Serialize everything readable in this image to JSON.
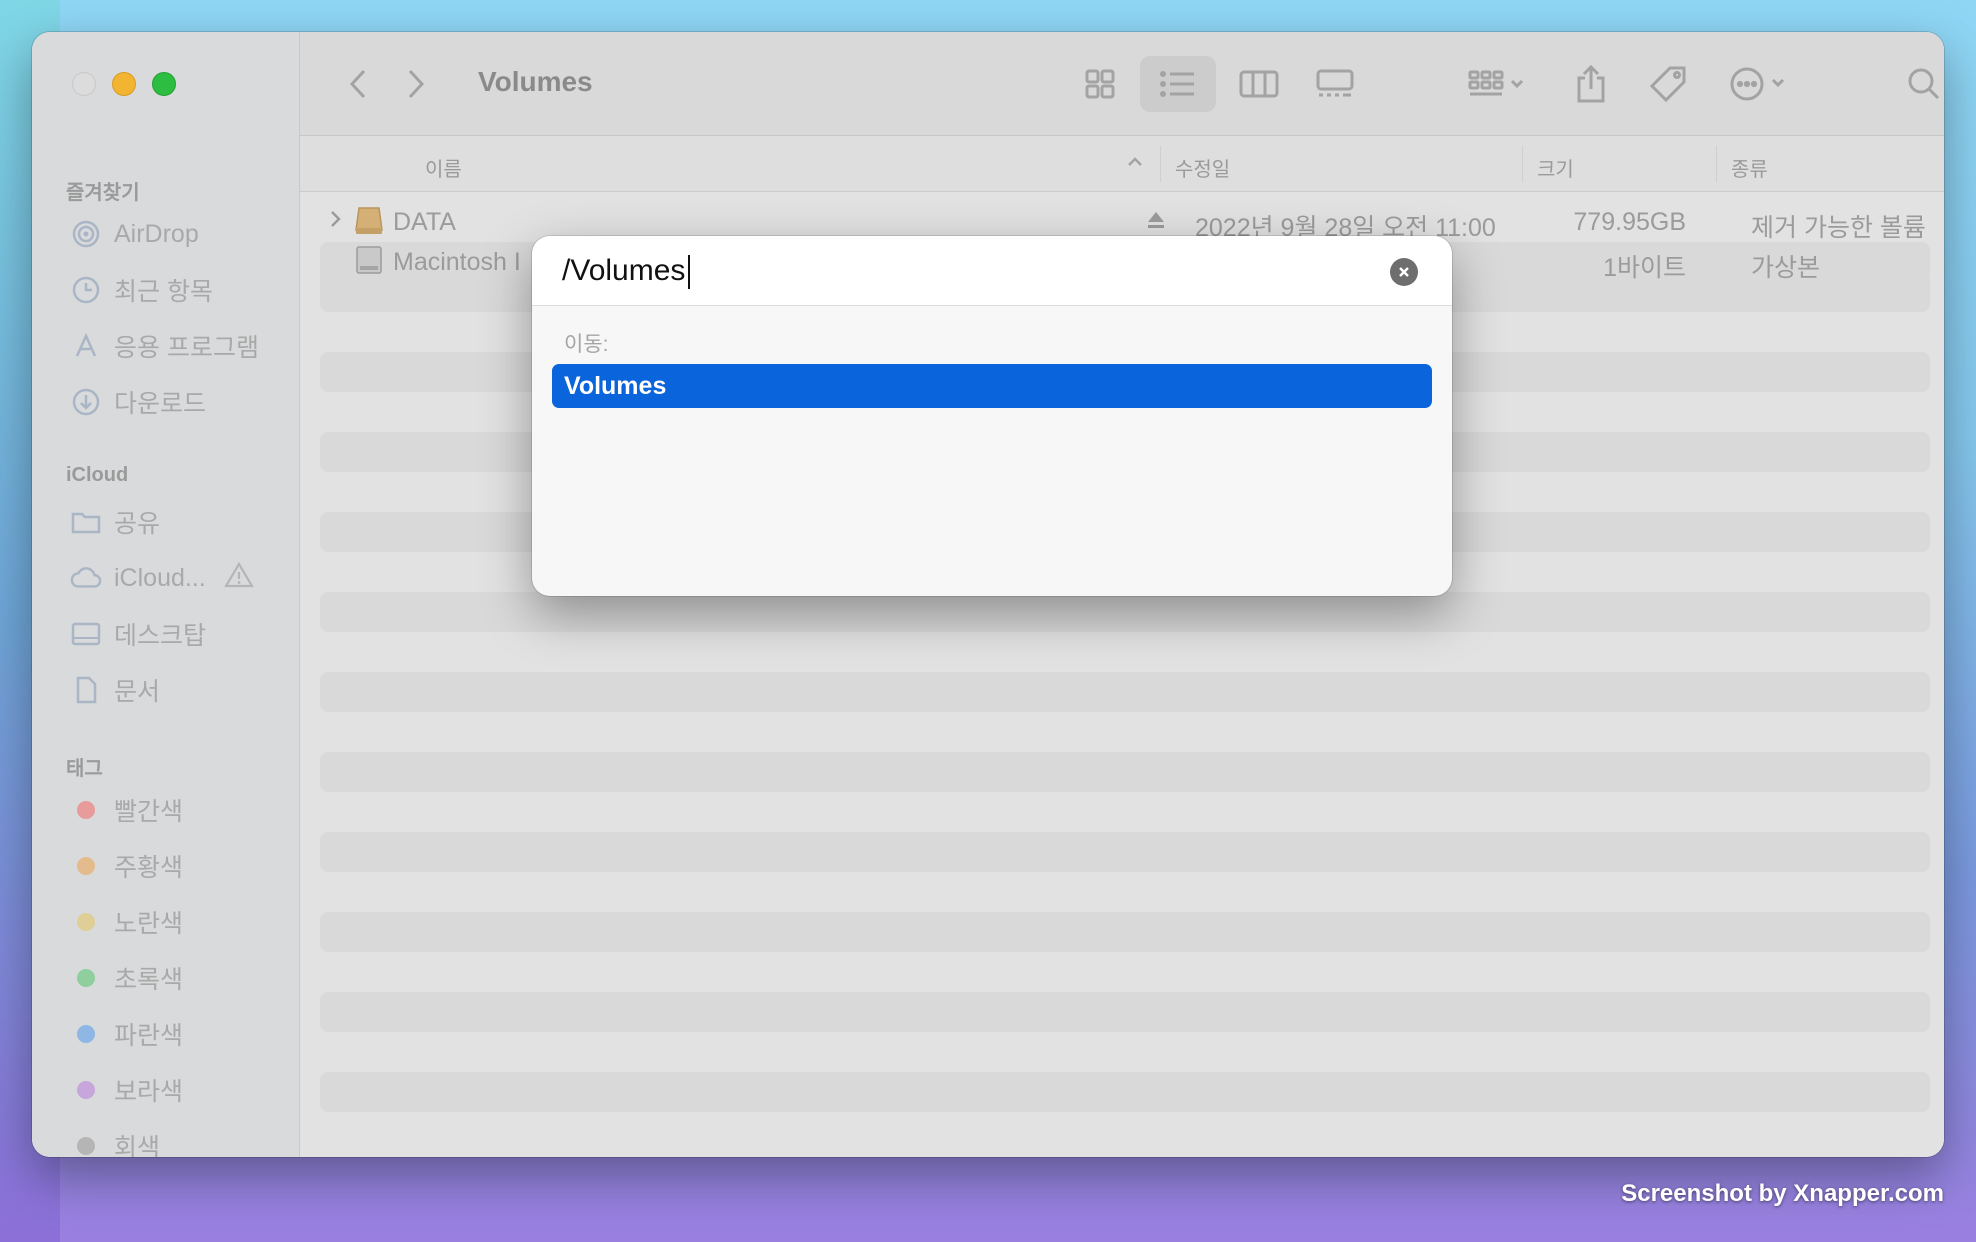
{
  "window": {
    "title": "Volumes"
  },
  "sidebar": {
    "favorites_header": "즐겨찾기",
    "favorites": [
      {
        "label": "AirDrop",
        "icon": "airdrop-icon"
      },
      {
        "label": "최근 항목",
        "icon": "clock-icon"
      },
      {
        "label": "응용 프로그램",
        "icon": "applications-icon"
      },
      {
        "label": "다운로드",
        "icon": "download-icon"
      }
    ],
    "icloud_header": "iCloud",
    "icloud": [
      {
        "label": "공유",
        "icon": "shared-folder-icon"
      },
      {
        "label": "iCloud...",
        "icon": "cloud-icon"
      },
      {
        "label": "데스크탑",
        "icon": "desktop-icon"
      },
      {
        "label": "문서",
        "icon": "document-icon"
      }
    ],
    "tags_header": "태그",
    "tags": [
      {
        "label": "빨간색",
        "color": "#e46c6c"
      },
      {
        "label": "주황색",
        "color": "#e6a462"
      },
      {
        "label": "노란색",
        "color": "#e2c96a"
      },
      {
        "label": "초록색",
        "color": "#5cc073"
      },
      {
        "label": "파란색",
        "color": "#5a9ee8"
      },
      {
        "label": "보라색",
        "color": "#b985d8"
      },
      {
        "label": "회색",
        "color": "#9b9b9b"
      }
    ]
  },
  "columns": {
    "name": "이름",
    "modified": "수정일",
    "size": "크기",
    "kind": "종류"
  },
  "files": [
    {
      "name": "DATA",
      "modified": "2022년 9월 28일 오전 11:00",
      "size": "779.95GB",
      "kind": "제거 가능한 볼륨"
    },
    {
      "name": "Macintosh I",
      "modified": "",
      "size": "1바이트",
      "kind": "가상본"
    }
  ],
  "goto_dialog": {
    "input_value": "/Volumes",
    "section_label": "이동:",
    "suggestion": "Volumes"
  },
  "watermark": "Screenshot by Xnapper.com"
}
